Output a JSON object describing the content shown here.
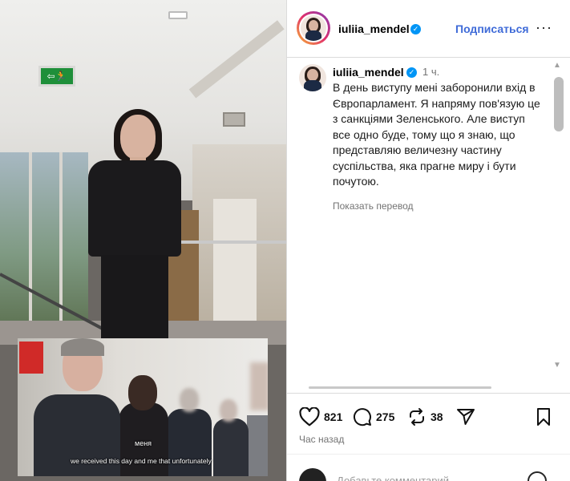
{
  "header": {
    "username": "iuliia_mendel",
    "follow_label": "Подписаться",
    "more_label": "···"
  },
  "post": {
    "username": "iuliia_mendel",
    "time": "1 ч.",
    "caption": "В день виступу мені заборонили вхід в Європарламент. Я напряму пов'язую це з санкціями Зеленського. Але виступ все одно буде, тому що я знаю, що представляю величезну частину суспільства, яка прагне миру і бути почутою.",
    "translate_label": "Показать перевод"
  },
  "media": {
    "exit_sign": "⇦🏃",
    "inset_caption_small": "меня",
    "inset_caption_main": "we received this day and me that unfortunately"
  },
  "actions": {
    "likes": "821",
    "comments": "275",
    "reposts": "38",
    "time_ago": "Час назад"
  },
  "comment": {
    "placeholder": "Добавьте комментарий..."
  },
  "icons": [
    "verified-badge-icon",
    "heart-icon",
    "comment-icon",
    "repost-icon",
    "share-icon",
    "bookmark-icon",
    "more-icon",
    "emoji-icon"
  ],
  "colors": {
    "follow": "#3f6bd8",
    "verified": "#0095f6",
    "muted": "#737373"
  }
}
